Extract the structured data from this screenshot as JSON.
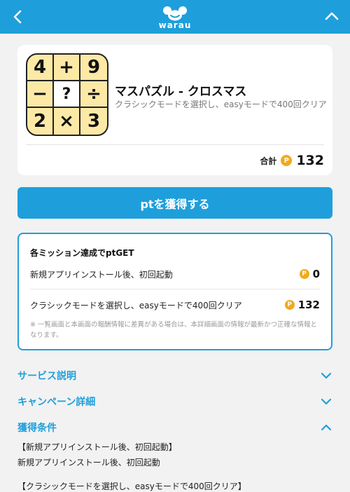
{
  "header": {
    "logo_text": "warau",
    "back_icon": "chevron-left-icon",
    "collapse_icon": "chevron-up-icon",
    "bg_color": "#1e9fdb"
  },
  "app": {
    "icon_cells": [
      "4",
      "+",
      "9",
      "−",
      "?",
      "÷",
      "2",
      "×",
      "3"
    ],
    "title": "マスパズル - クロスマス",
    "subtitle": "クラシックモードを選択し、easyモードで400回クリア",
    "total_label": "合計",
    "coin_symbol": "P",
    "total_value": "132"
  },
  "cta": {
    "label": "ptを獲得する"
  },
  "mission": {
    "heading": "各ミッション達成でptGET",
    "items": [
      {
        "label": "新規アプリインストール後、初回起動",
        "value": "0"
      },
      {
        "label": "クラシックモードを選択し、easyモードで400回クリア",
        "value": "132"
      }
    ],
    "note": "※ 一覧画面と本画面の報酬情報に差異がある場合は、本詳細画面の情報が最新かつ正確な情報となります。"
  },
  "sections": [
    {
      "label": "サービス説明",
      "state": "collapsed"
    },
    {
      "label": "キャンペーン詳細",
      "state": "collapsed"
    },
    {
      "label": "獲得条件",
      "state": "expanded"
    }
  ],
  "conditions": {
    "line1": "【新規アプリインストール後、初回起動】",
    "line2": "新規アプリインストール後、初回起動",
    "line3": "【クラシックモードを選択し、easyモードで400回クリア】"
  },
  "colors": {
    "accent": "#1e9fdb",
    "coin": "#f2a91c",
    "icon_bg": "#fde9a6"
  }
}
